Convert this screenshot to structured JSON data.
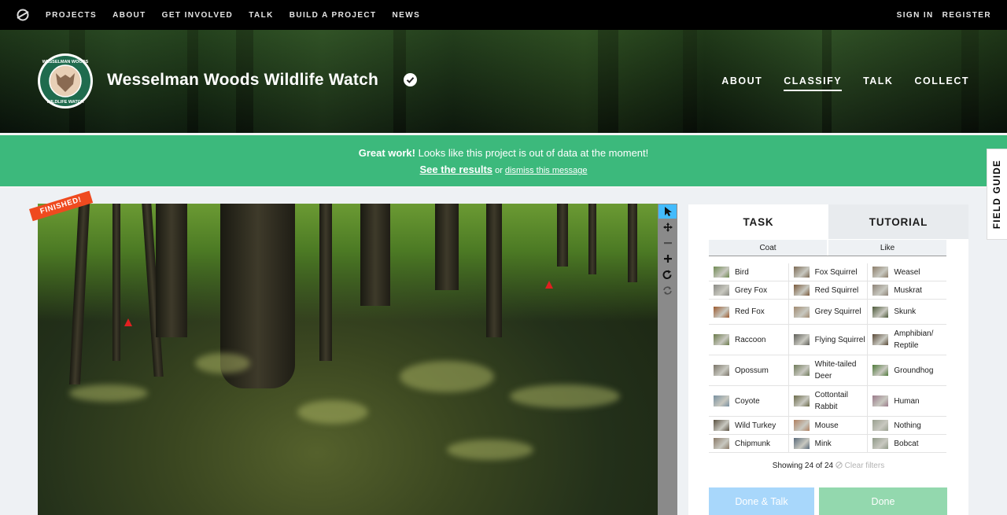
{
  "topnav": {
    "links": [
      "PROJECTS",
      "ABOUT",
      "GET INVOLVED",
      "TALK",
      "BUILD A PROJECT",
      "NEWS"
    ],
    "sign_in": "SIGN IN",
    "register": "REGISTER"
  },
  "project": {
    "badge_text": "WESSELMAN WOODS WILDLIFE WATCH",
    "title": "Wesselman Woods Wildlife Watch",
    "nav": [
      "ABOUT",
      "CLASSIFY",
      "TALK",
      "COLLECT"
    ],
    "active_nav": "CLASSIFY"
  },
  "banner": {
    "bold": "Great work!",
    "message": " Looks like this project is out of data at the moment!",
    "results_link": "See the results",
    "or": " or ",
    "dismiss_link": "dismiss this message"
  },
  "field_guide": "FIELD GUIDE",
  "subject": {
    "status_ribbon": "FINISHED!"
  },
  "toolbar_icons": [
    "pointer-icon",
    "pan-icon",
    "zoom-out-icon",
    "zoom-in-icon",
    "rotate-icon",
    "reset-icon"
  ],
  "task_panel": {
    "tabs": [
      "TASK",
      "TUTORIAL"
    ],
    "filters": [
      "Coat",
      "Like"
    ],
    "choices": [
      [
        "Bird",
        "Fox Squirrel",
        "Weasel"
      ],
      [
        "Grey Fox",
        "Red Squirrel",
        "Muskrat"
      ],
      [
        "Red Fox",
        "Grey Squirrel",
        "Skunk"
      ],
      [
        "Raccoon",
        "Flying Squirrel",
        "Amphibian/ Reptile"
      ],
      [
        "Opossum",
        "White-tailed Deer",
        "Groundhog"
      ],
      [
        "Coyote",
        "Cottontail Rabbit",
        "Human"
      ],
      [
        "Wild Turkey",
        "Mouse",
        "Nothing"
      ],
      [
        "Chipmunk",
        "Mink",
        "Bobcat"
      ]
    ],
    "showing": "Showing 24 of 24",
    "clear_filters": "Clear filters",
    "done_talk": "Done & Talk",
    "done": "Done"
  },
  "colors": {
    "banner": "#3cb97c",
    "ribbon": "#ef4a1f",
    "done_talk_button": "#a8d7fb",
    "done_button": "#93d8ae",
    "selected_tool": "#43bbfd"
  }
}
